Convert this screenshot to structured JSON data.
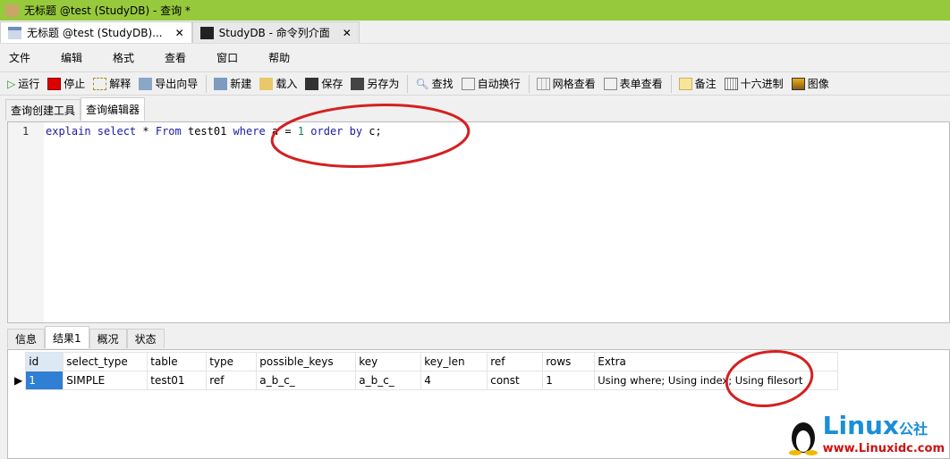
{
  "title": "无标题 @test (StudyDB) - 查询 *",
  "tabs": [
    {
      "label": "无标题 @test (StudyDB)..."
    },
    {
      "label": "StudyDB - 命令列介面"
    }
  ],
  "close_glyph": "✕",
  "menu": [
    "文件",
    "编辑",
    "格式",
    "查看",
    "窗口",
    "帮助"
  ],
  "toolbar": [
    "运行",
    "停止",
    "解释",
    "导出向导",
    "新建",
    "载入",
    "保存",
    "另存为",
    "查找",
    "自动换行",
    "网格查看",
    "表单查看",
    "备注",
    "十六进制",
    "图像"
  ],
  "subtabs": [
    "查询创建工具",
    "查询编辑器"
  ],
  "editor": {
    "line": "1",
    "code": {
      "k1": "explain select",
      "t1": " * ",
      "k2": "From",
      "t2": " test01 ",
      "k3": "where",
      "t3": " a = ",
      "n1": "1",
      "t4": " ",
      "k4": "order by",
      "t5": " c;"
    }
  },
  "result_tabs": [
    "信息",
    "结果1",
    "概况",
    "状态"
  ],
  "grid": {
    "columns": [
      "id",
      "select_type",
      "table",
      "type",
      "possible_keys",
      "key",
      "key_len",
      "ref",
      "rows",
      "Extra"
    ],
    "rows": [
      [
        "1",
        "SIMPLE",
        "test01",
        "ref",
        "a_b_c_",
        "a_b_c_",
        "4",
        "const",
        "1",
        "Using where; Using index; Using filesort"
      ]
    ]
  },
  "logo": {
    "name": "Linux",
    "suffix": "公社",
    "url": "www.Linuxidc.com"
  },
  "colors": {
    "titlebar": "#97c93c",
    "annotation": "#d42020",
    "selection": "#2f7fd4"
  }
}
